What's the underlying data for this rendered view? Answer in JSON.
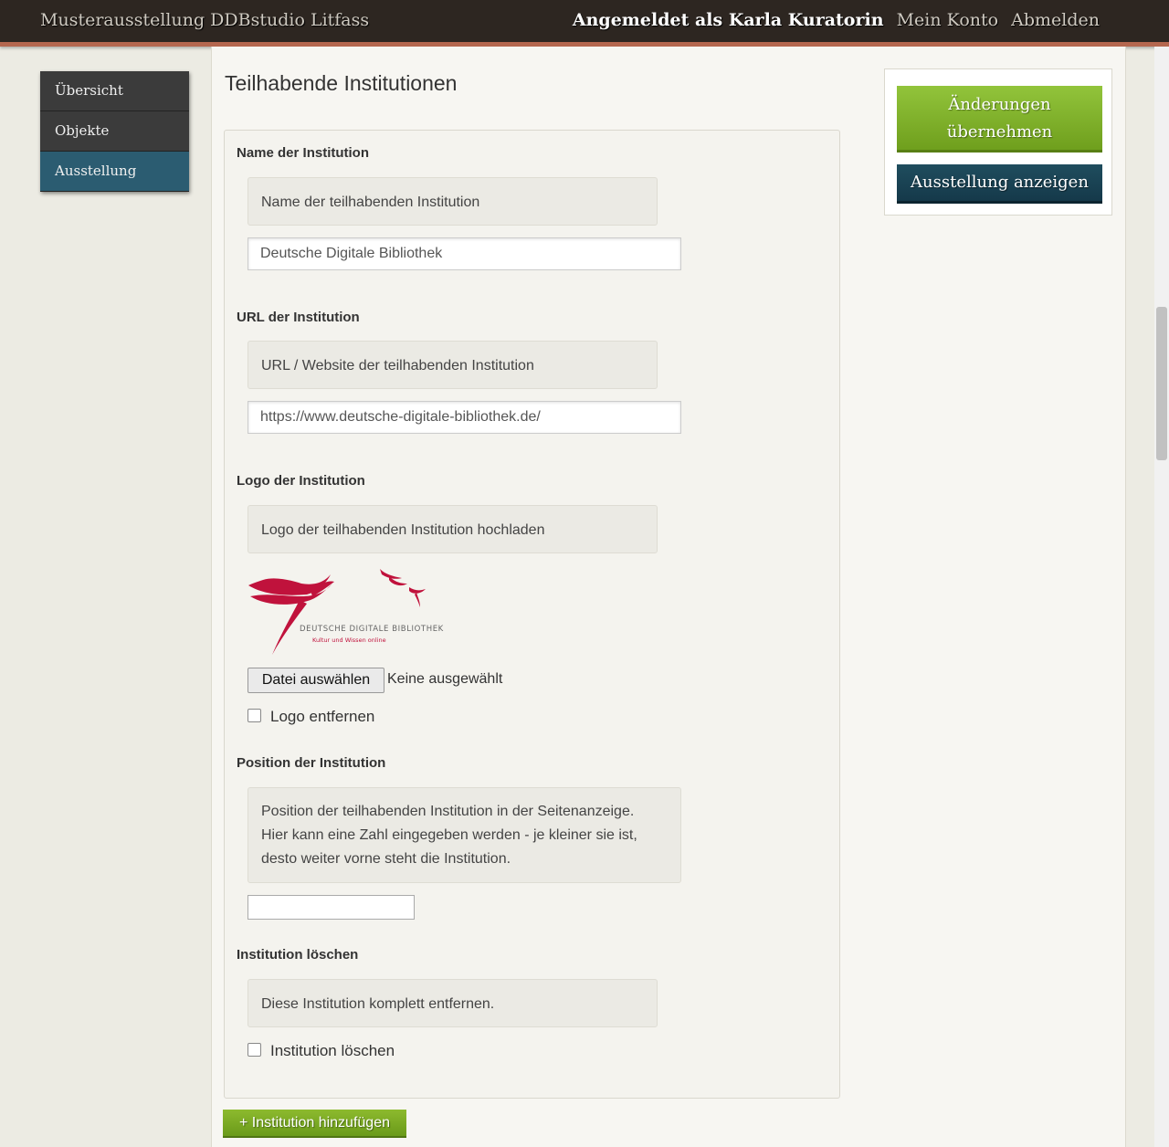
{
  "header": {
    "site_title": "Musterausstellung DDBstudio Litfass",
    "logged_in": "Angemeldet als Karla Kuratorin",
    "account_link": "Mein Konto",
    "logout_link": "Abmelden"
  },
  "sidebar": {
    "items": [
      {
        "label": "Übersicht"
      },
      {
        "label": "Objekte"
      },
      {
        "label": "Ausstellung"
      }
    ]
  },
  "main": {
    "title": "Teilhabende Institutionen",
    "name": {
      "label": "Name der Institution",
      "hint": "Name der teilhabenden Institution",
      "value": "Deutsche Digitale Bibliothek"
    },
    "url": {
      "label": "URL der Institution",
      "hint": "URL / Website der teilhabenden Institution",
      "value": "https://www.deutsche-digitale-bibliothek.de/"
    },
    "logo": {
      "label": "Logo der Institution",
      "hint": "Logo der teilhabenden Institution hochladen",
      "logo_text_line1": "DEUTSCHE DIGITALE BIBLIOTHEK",
      "logo_text_line2": "Kultur und Wissen online",
      "file_button": "Datei auswählen",
      "file_status": "Keine ausgewählt",
      "remove_label": "Logo entfernen"
    },
    "position": {
      "label": "Position der Institution",
      "hint_line1": "Position der teilhabenden Institution in der Seitenanzeige.",
      "hint_line2": "Hier kann eine Zahl eingegeben werden - je kleiner sie ist,",
      "hint_line3": "desto weiter vorne steht die Institution.",
      "value": ""
    },
    "delete": {
      "label": "Institution löschen",
      "hint": "Diese Institution komplett entfernen.",
      "checkbox_label": "Institution löschen"
    },
    "add_button": "+ Institution hinzufügen"
  },
  "actions": {
    "apply_line1": "Änderungen",
    "apply_line2": "übernehmen",
    "view": "Ausstellung anzeigen"
  },
  "colors": {
    "topbar": "#2d2621",
    "topbar_accent": "#b5674f",
    "nav_active": "#2b5c71",
    "green_button": "#7fae24",
    "blue_button": "#1a4556",
    "logo_red": "#c0123c"
  }
}
